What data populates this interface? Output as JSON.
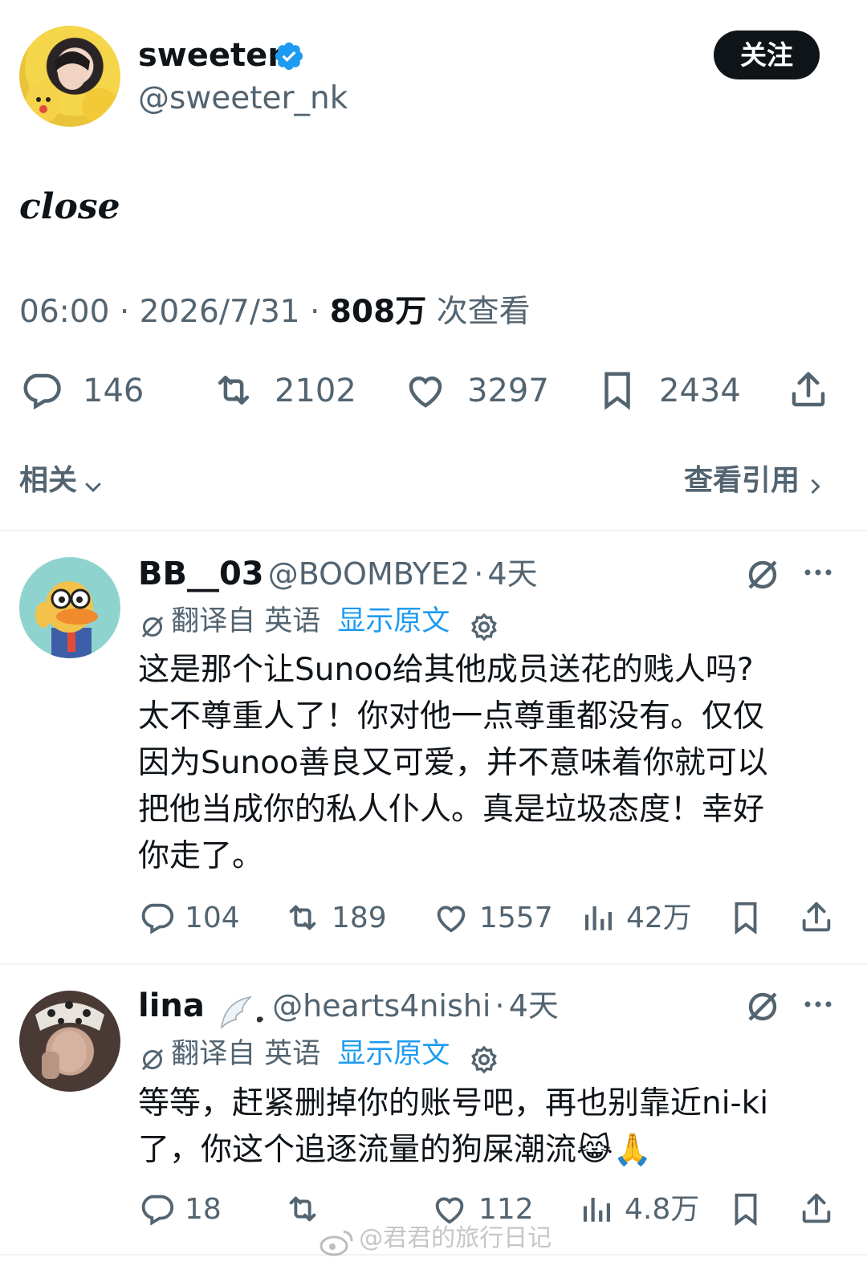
{
  "post": {
    "display_name": "sweeter",
    "handle": "@sweeter_nk",
    "follow_label": "关注",
    "text": "close",
    "time": "06:00",
    "date": "2026/7/31",
    "views_count": "808万",
    "views_label": "次查看",
    "stats": {
      "replies": "146",
      "reposts": "2102",
      "likes": "3297",
      "bookmarks": "2434"
    }
  },
  "related": {
    "label": "相关",
    "quotes_label": "查看引用"
  },
  "replies": [
    {
      "display_name": "BB__03",
      "handle": "@BOOMBYE2",
      "age": "4天",
      "translated_from": "翻译自 英语",
      "show_original": "显示原文",
      "text": "这是那个让Sunoo给其他成员送花的贱人吗?\n太不尊重人了！你对他一点尊重都没有。仅仅\n因为Sunoo善良又可爱，并不意味着你就可以\n把他当成你的私人仆人。真是垃圾态度！幸好\n你走了。",
      "stats": {
        "replies": "104",
        "reposts": "189",
        "likes": "1557",
        "views": "42万"
      }
    },
    {
      "display_name": "lina",
      "handle": "@hearts4nishi",
      "age": "4天",
      "translated_from": "翻译自 英语",
      "show_original": "显示原文",
      "text": "等等，赶紧删掉你的账号吧，再也别靠近ni-ki\n了，你这个追逐流量的狗屎潮流😹🙏",
      "stats": {
        "replies": "18",
        "reposts": "",
        "likes": "112",
        "views": "4.8万"
      }
    }
  ],
  "watermark": "@君君的旅行日记",
  "colors": {
    "verified": "#1d9bf0",
    "link": "#1d9bf0",
    "muted": "#536471",
    "text": "#0f1419"
  }
}
